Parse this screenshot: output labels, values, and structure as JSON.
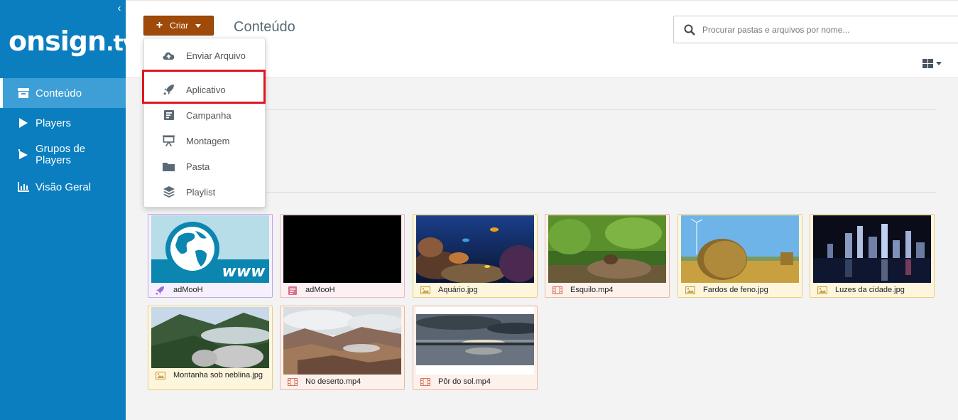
{
  "app": {
    "logo_text": "onsign",
    "logo_suffix": ".tv"
  },
  "sidebar": {
    "items": [
      {
        "label": "Conteúdo",
        "icon": "archive-icon",
        "active": true
      },
      {
        "label": "Players",
        "icon": "play-icon"
      },
      {
        "label": "Grupos de Players",
        "icon": "player-group-icon"
      },
      {
        "label": "Visão Geral",
        "icon": "bar-chart-icon"
      }
    ]
  },
  "toolbar": {
    "create_label": "Criar",
    "page_title": "Conteúdo"
  },
  "search": {
    "placeholder": "Procurar pastas e arquivos por nome..."
  },
  "dropdown": {
    "items": [
      {
        "label": "Enviar Arquivo",
        "icon": "cloud-upload-icon"
      },
      {
        "label": "Aplicativo",
        "icon": "rocket-icon",
        "highlighted": true
      },
      {
        "label": "Campanha",
        "icon": "campaign-icon"
      },
      {
        "label": "Montagem",
        "icon": "presentation-icon"
      },
      {
        "label": "Pasta",
        "icon": "folder-icon"
      },
      {
        "label": "Playlist",
        "icon": "layers-icon"
      }
    ]
  },
  "files": [
    {
      "name": "adMooH",
      "kind": "app",
      "icon": "rocket-icon"
    },
    {
      "name": "adMooH",
      "kind": "campaign",
      "icon": "campaign-icon"
    },
    {
      "name": "Aquário.jpg",
      "kind": "image",
      "icon": "image-icon"
    },
    {
      "name": "Esquilo.mp4",
      "kind": "video",
      "icon": "film-icon"
    },
    {
      "name": "Fardos de feno.jpg",
      "kind": "image",
      "icon": "image-icon"
    },
    {
      "name": "Luzes da cidade.jpg",
      "kind": "image",
      "icon": "image-icon"
    },
    {
      "name": "Montanha sob neblina.jpg",
      "kind": "image",
      "icon": "image-icon"
    },
    {
      "name": "No deserto.mp4",
      "kind": "video",
      "icon": "film-icon"
    },
    {
      "name": "Pôr do sol.mp4",
      "kind": "video",
      "icon": "film-icon"
    }
  ],
  "colors": {
    "sidebar": "#0a7ebf",
    "sidebar_active": "#3e9fd6",
    "create_button": "#a04a0a",
    "highlight_box": "#e0161f"
  }
}
